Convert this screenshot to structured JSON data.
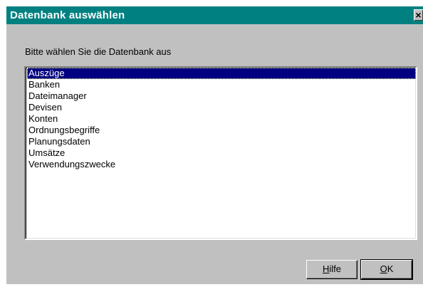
{
  "window": {
    "title": "Datenbank auswählen",
    "close_glyph": "×"
  },
  "prompt": "Bitte wählen Sie die Datenbank aus",
  "list": {
    "selected_index": 0,
    "items": [
      "Auszüge",
      "Banken",
      "Dateimanager",
      "Devisen",
      "Konten",
      "Ordnungsbegriffe",
      "Planungsdaten",
      "Umsätze",
      "Verwendungszwecke"
    ]
  },
  "buttons": {
    "help": {
      "hotkey": "H",
      "rest": "ilfe"
    },
    "ok": {
      "hotkey": "O",
      "rest": "K"
    }
  },
  "colors": {
    "titlebar": "#008080",
    "selection": "#000080",
    "face": "#c0c0c0"
  }
}
